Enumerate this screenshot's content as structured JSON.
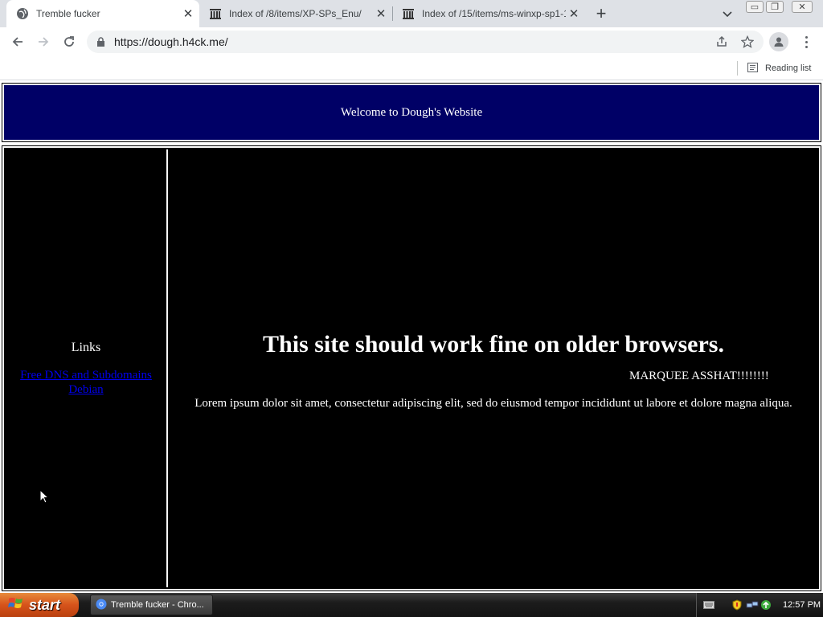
{
  "browser": {
    "tabs": [
      {
        "title": "Tremble fucker",
        "active": true
      },
      {
        "title": "Index of /8/items/XP-SPs_Enu/",
        "active": false
      },
      {
        "title": "Index of /15/items/ms-winxp-sp1-1",
        "active": false
      }
    ],
    "url": "https://dough.h4ck.me/",
    "reading_list_label": "Reading list"
  },
  "page": {
    "header_text": "Welcome to Dough's Website",
    "links_heading": "Links",
    "links": [
      {
        "label": "Free DNS and Subdomains"
      },
      {
        "label": "Debian"
      }
    ],
    "main_heading": "This site should work fine on older browsers.",
    "marquee_text": "MARQUEE ASSHAT!!!!!!!!",
    "lorem_text": "Lorem ipsum dolor sit amet, consectetur adipiscing elit, sed do eiusmod tempor incididunt ut labore et dolore magna aliqua.",
    "colors": {
      "header_bg": "#000066",
      "body_bg": "#000000",
      "text": "#ffffff",
      "link": "#0000ee"
    }
  },
  "taskbar": {
    "start_label": "start",
    "task_item_label": "Tremble fucker - Chro...",
    "clock": "12:57 PM"
  }
}
